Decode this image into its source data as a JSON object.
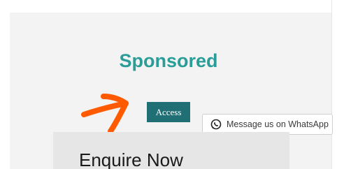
{
  "section": {
    "title": "Sponsored",
    "access_label": "Access"
  },
  "whatsapp": {
    "label": "Message us on WhatsApp",
    "icon": "whatsapp-icon"
  },
  "enquiry": {
    "title": "Enquire Now"
  },
  "annotation": {
    "icon": "hand-drawn-arrow-icon"
  },
  "colors": {
    "title": "#2a9d98",
    "access_button": "#1f6f74",
    "arrow": "#ff5a00",
    "panel": "#f3f3f3",
    "enquiry_box": "#e6e6e6"
  }
}
